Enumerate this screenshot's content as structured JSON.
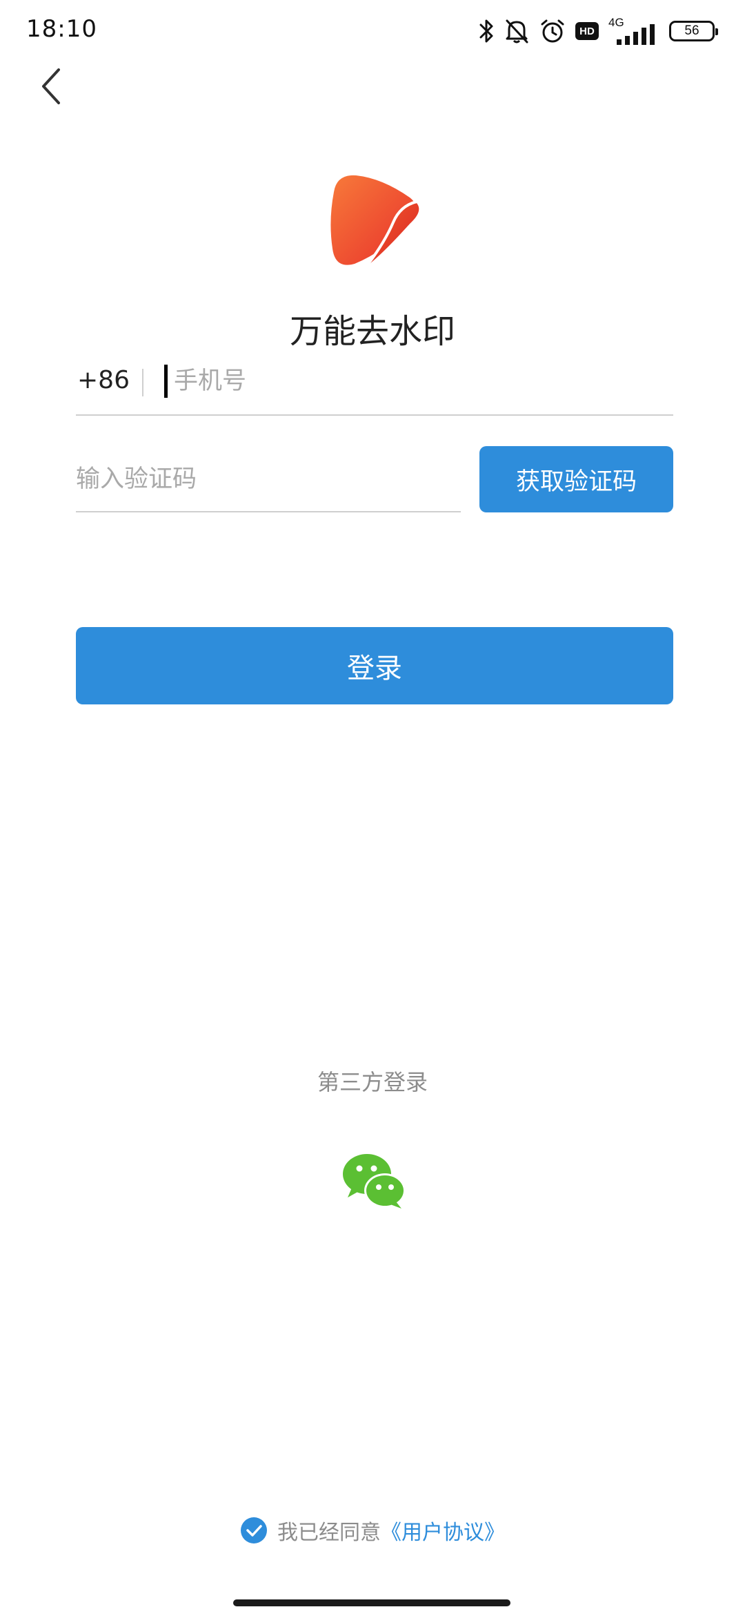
{
  "status_bar": {
    "time": "18:10",
    "network_label": "4G",
    "battery_level": "56",
    "icons": [
      "bluetooth-icon",
      "bell-muted-icon",
      "alarm-icon",
      "hd-icon",
      "signal-icon",
      "battery-icon"
    ],
    "hd_label": "HD"
  },
  "header": {
    "back_icon": "chevron-left-icon"
  },
  "app": {
    "logo_icon": "play-logo-icon",
    "title": "万能去水印"
  },
  "form": {
    "country_code": "+86",
    "phone_placeholder": "手机号",
    "phone_value": "",
    "code_placeholder": "输入验证码",
    "code_value": "",
    "get_code_label": "获取验证码",
    "login_label": "登录"
  },
  "third_party": {
    "label": "第三方登录",
    "wechat_icon": "wechat-icon"
  },
  "agreement": {
    "checked": true,
    "text": "我已经同意",
    "link_text": "《用户协议》"
  },
  "colors": {
    "accent": "#2e8ddb",
    "wechat": "#5bbf33",
    "logo_start": "#f25a2c",
    "logo_end": "#e8302b",
    "placeholder": "#a9a9a9",
    "muted_text": "#8c8c8c"
  }
}
